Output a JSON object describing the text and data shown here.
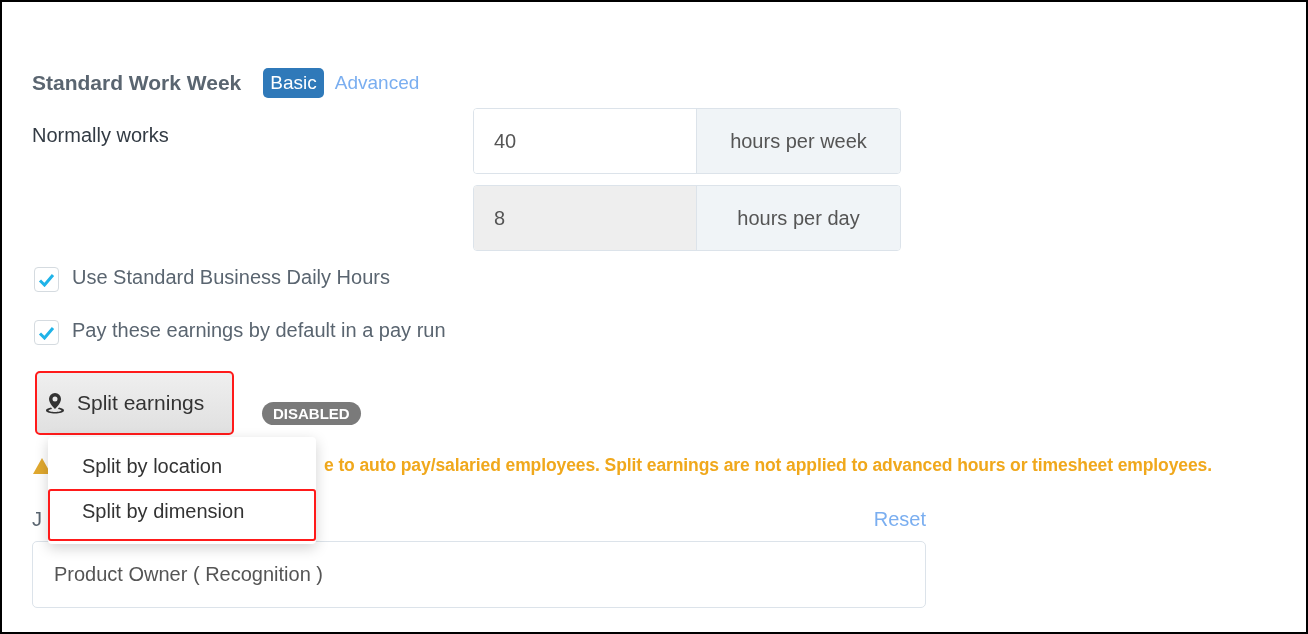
{
  "section": {
    "title": "Standard Work Week",
    "modes": [
      {
        "label": "Basic",
        "selected": true
      },
      {
        "label": "Advanced",
        "selected": false
      }
    ]
  },
  "hours": {
    "label": "Normally works",
    "fields": [
      {
        "value": "40",
        "unit": "hours per week",
        "disabled": false
      },
      {
        "value": "8",
        "unit": "hours per day",
        "disabled": true
      }
    ]
  },
  "options": [
    {
      "label": "Use Standard Business Daily Hours",
      "checked": true
    },
    {
      "label": "Pay these earnings by default in a pay run",
      "checked": true
    }
  ],
  "split": {
    "button": {
      "label": "Split earnings",
      "highlighted": true
    },
    "status": "DISABLED",
    "menu": [
      {
        "label": "Split by location",
        "highlighted": false
      },
      {
        "label": "Split by dimension",
        "highlighted": true
      }
    ],
    "warning": "e to auto pay/salaried employees. Split earnings are not applied to advanced hours or timesheet employees."
  },
  "job": {
    "label": "J",
    "reset": "Reset",
    "value": "Product Owner ( Recognition )"
  }
}
